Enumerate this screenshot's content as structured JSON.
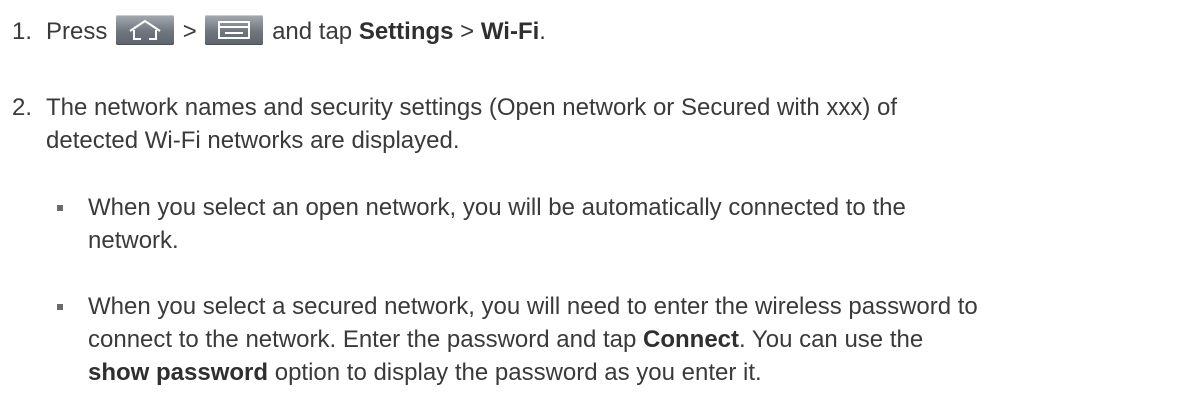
{
  "steps": [
    {
      "number": "1.",
      "press": "Press",
      "gt1": ">",
      "and_tap": "and tap",
      "settings": "Settings",
      "gt2": ">",
      "wifi": "Wi-Fi",
      "end": ".",
      "icons": [
        "home-key-icon",
        "menu-key-icon"
      ]
    },
    {
      "number": "2.",
      "line1": "The network names and security settings (Open network or Secured with xxx) of",
      "line2": "detected Wi-Fi networks are displayed."
    }
  ],
  "bullets": [
    {
      "line1": "When you select an open network, you will be automatically connected to the",
      "line2": "network."
    },
    {
      "line1": "When you select a secured network, you will need to enter the wireless password to",
      "line2_a": "connect to the network. Enter the password and tap",
      "connect": "Connect",
      "line2_b": ". You can use the",
      "show_password": "show password",
      "line3": "option to display the password as you enter it."
    }
  ]
}
